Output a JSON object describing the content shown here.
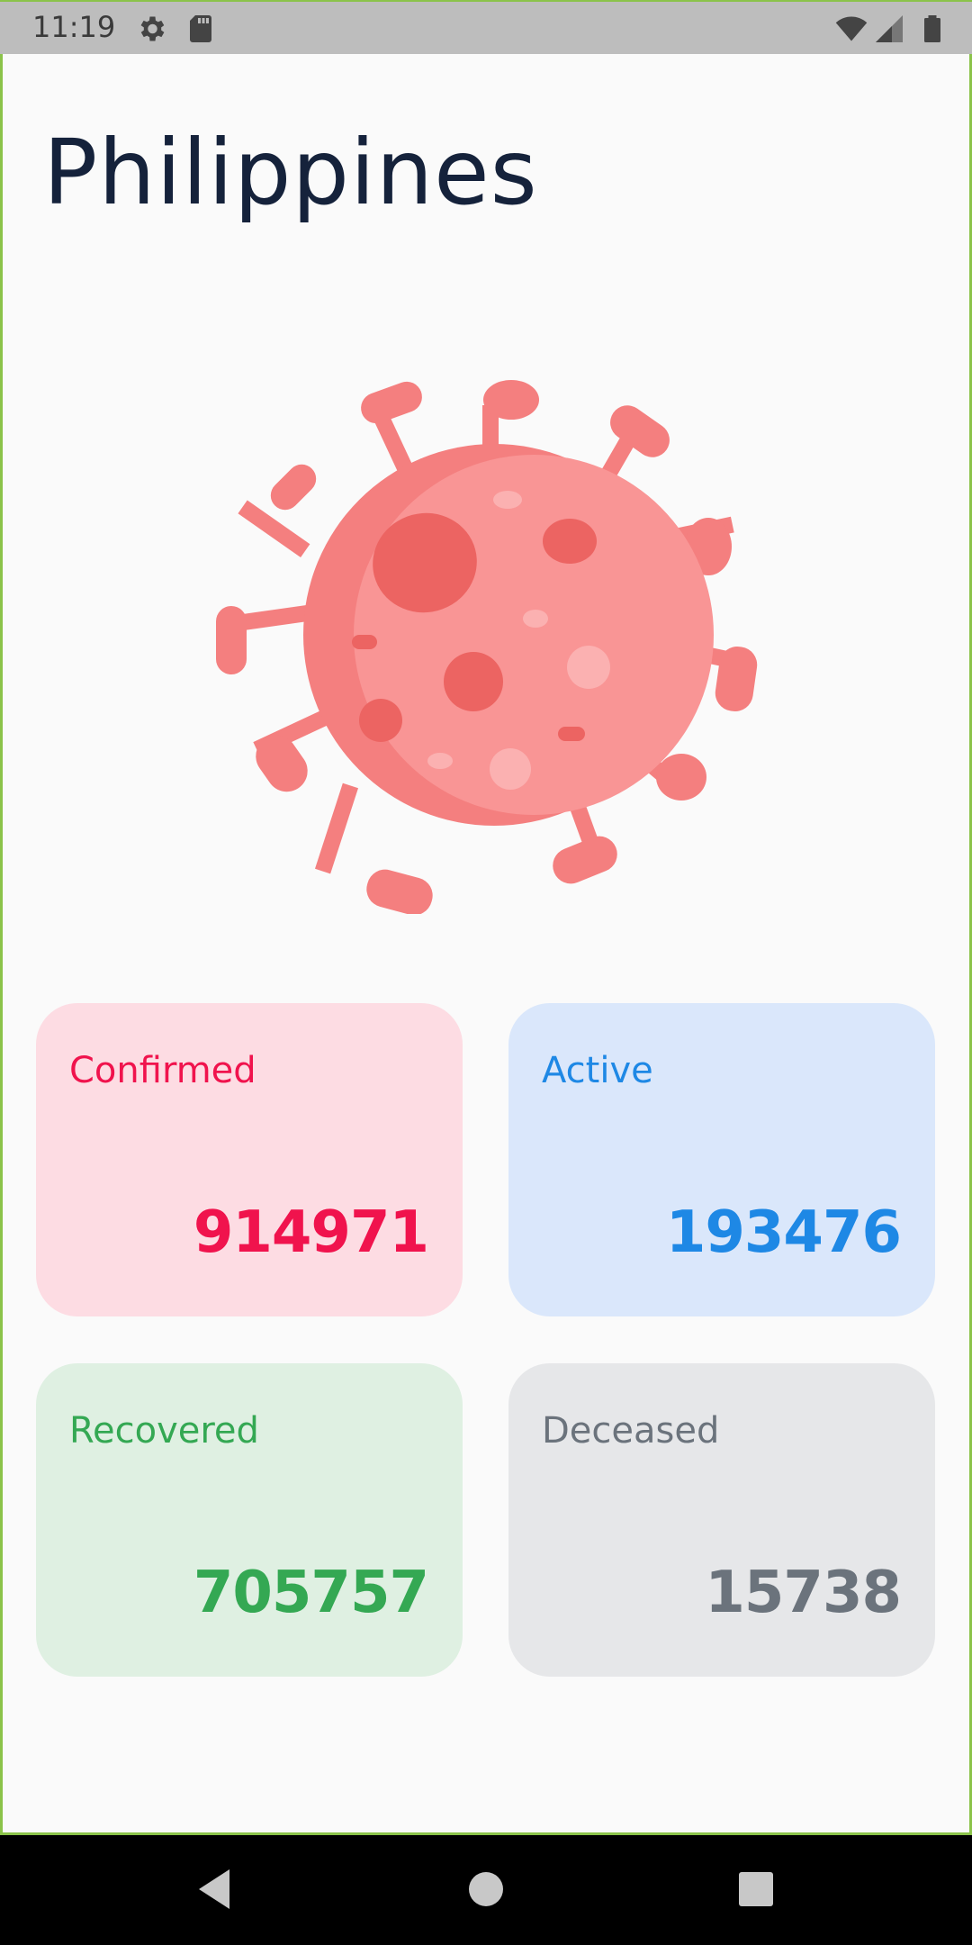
{
  "status_bar": {
    "time": "11:19",
    "icons": [
      "settings-icon",
      "sd-card-icon",
      "wifi-icon",
      "cell-signal-icon",
      "battery-icon"
    ]
  },
  "header": {
    "country": "Philippines"
  },
  "illustration": {
    "icon": "virus-icon",
    "color": "#f47f7f"
  },
  "stats": {
    "confirmed": {
      "label": "Confirmed",
      "value": "914971",
      "color": "#f0134d",
      "background": "#fddce3"
    },
    "active": {
      "label": "Active",
      "value": "193476",
      "color": "#1e88e5",
      "background": "#dae7fb"
    },
    "recovered": {
      "label": "Recovered",
      "value": "705757",
      "color": "#34a853",
      "background": "#dff0e2"
    },
    "deceased": {
      "label": "Deceased",
      "value": "15738",
      "color": "#6b737c",
      "background": "#e6e7e9"
    }
  },
  "nav_bar": {
    "buttons": [
      "back-icon",
      "home-icon",
      "recents-icon"
    ]
  }
}
